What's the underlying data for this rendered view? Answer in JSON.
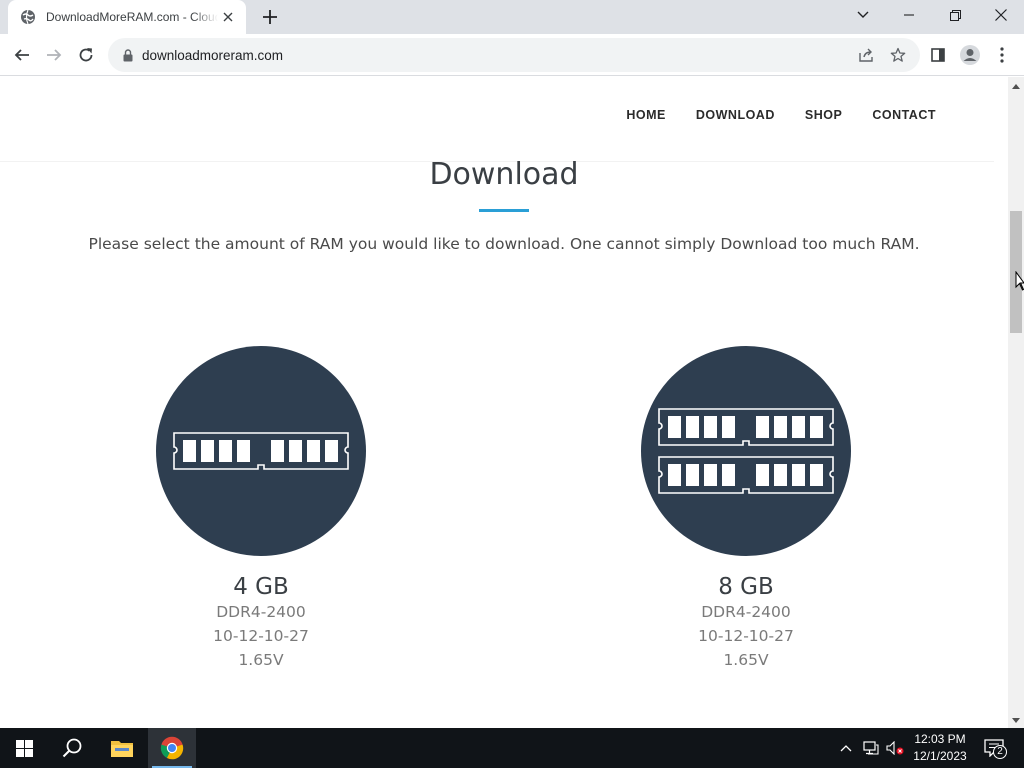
{
  "browser": {
    "tab_title": "DownloadMoreRAM.com - Cloudflare",
    "new_tab_symbol": "+",
    "url": "downloadmoreram.com"
  },
  "site": {
    "nav": [
      {
        "label": "HOME"
      },
      {
        "label": "DOWNLOAD"
      },
      {
        "label": "SHOP"
      },
      {
        "label": "CONTACT"
      }
    ],
    "heading": "Download",
    "lead": "Please select the amount of RAM you would like to download. One cannot simply Download too much RAM.",
    "accent_color": "#2a9fd6",
    "disc_color": "#2e3e50",
    "products": [
      {
        "size": "4 GB",
        "type": "DDR4-2400",
        "timings": "10-12-10-27",
        "voltage": "1.65V",
        "icon": "ram-stick-icon"
      },
      {
        "size": "8 GB",
        "type": "DDR4-2400",
        "timings": "10-12-10-27",
        "voltage": "1.65V",
        "icon": "ram-two-sticks-icon"
      }
    ]
  },
  "taskbar": {
    "time": "12:03 PM",
    "date": "12/1/2023",
    "notification_count": "2"
  }
}
